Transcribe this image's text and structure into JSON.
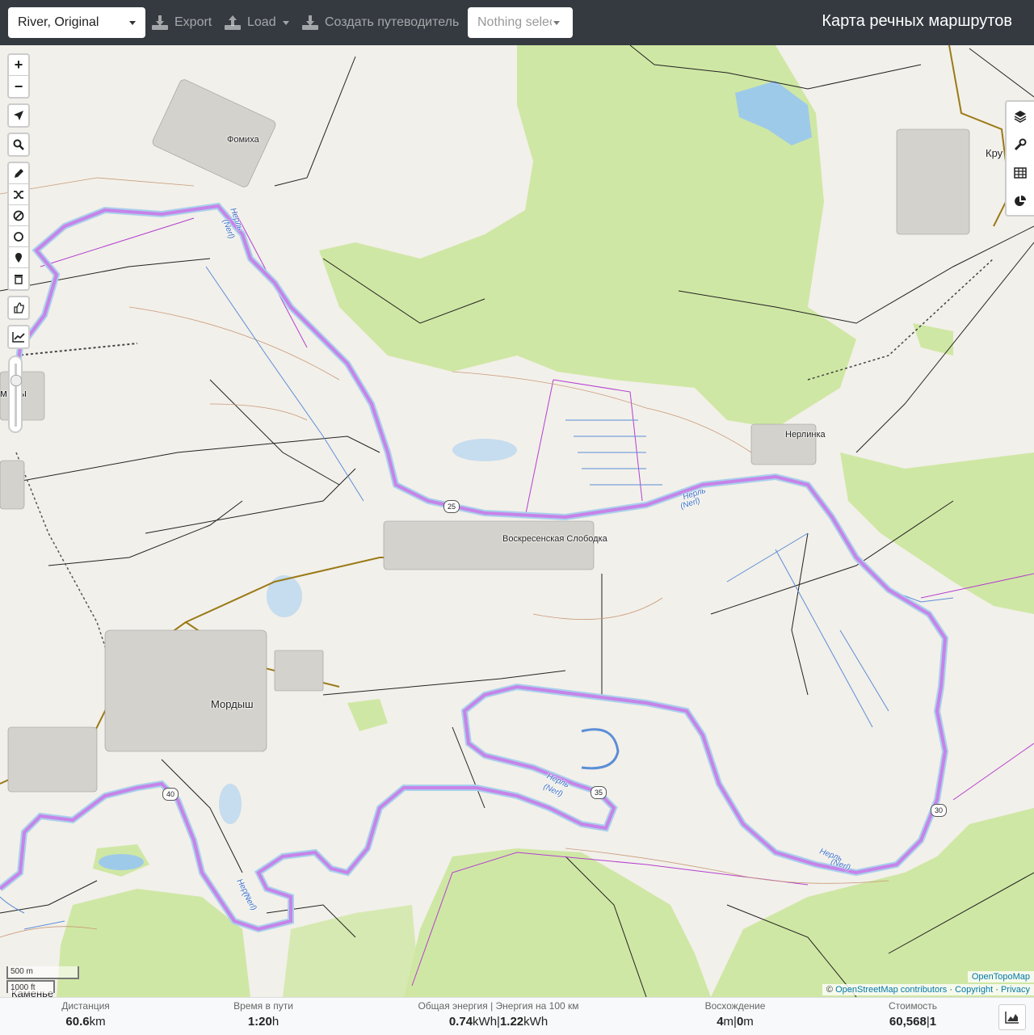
{
  "topbar": {
    "profile": "River, Original",
    "export_label": "Export",
    "load_label": "Load",
    "guide_label": "Создать путеводитель",
    "selection_label": "Nothing selected",
    "title": "Карта речных маршрутов"
  },
  "map": {
    "left_controls": [
      "zoom-in",
      "zoom-out",
      "locate",
      "search",
      "draw-route",
      "reverse-route",
      "delete-point",
      "add-circle",
      "add-marker",
      "clear-route",
      "strava-segments",
      "elevation-chart"
    ],
    "zoom_in": "+",
    "zoom_out": "−",
    "right_controls": [
      "layers-icon",
      "wrench-icon",
      "table-icon",
      "pie-chart-icon"
    ],
    "places": {
      "fomikha": "Фомиха",
      "nerlinka": "Нерлинка",
      "voskresenskaya": "Воскресенская Слободка",
      "mordysh": "Мордыш",
      "kru": "Кру",
      "mitsy": "мицы",
      "kamenye": "Каменье"
    },
    "river_labels": {
      "r1": "Нерль",
      "r1b": "(Nerl)",
      "r2": "Нерль",
      "r2b": "(Nerl)",
      "r3": "Нерль",
      "r3b": "(Nerl)",
      "r4": "Нерль",
      "r4b": "(Nerl)",
      "r5": "Нерль",
      "r5b": "(Nerl)"
    },
    "km_markers": {
      "k25": "25",
      "k30": "30",
      "k35": "35",
      "k40": "40"
    },
    "scale_metric": "500 m",
    "scale_imperial": "1000 ft",
    "attribution": {
      "tile": "OpenTopoMap",
      "prefix": "©",
      "osm": "OpenStreetMap contributors",
      "sep1": "·",
      "copyright": "Copyright",
      "sep2": "·",
      "privacy": "Privacy"
    }
  },
  "stats": {
    "distance_label": "Дистанция",
    "distance_value": "60.6",
    "distance_unit": "km",
    "time_label": "Время в пути",
    "time_value": "1:20",
    "time_unit": "h",
    "energy_label": "Общая энергия | Энергия на 100 км",
    "energy_total": "0.74",
    "energy_unit": "kWh",
    "energy_sep": "|",
    "energy_per100": "1.22",
    "energy_unit2": "kWh",
    "ascent_label": "Восхождение",
    "ascent_value": "4",
    "ascent_unit": "m",
    "ascent_sep": "|",
    "descent_value": "0",
    "descent_unit": "m",
    "cost_label": "Стоимость",
    "cost_value": "60,568",
    "cost_sep": "|",
    "cost_value2": "1"
  },
  "colors": {
    "route": "#c87ee8",
    "river": "#9ecae9",
    "forest": "#cfe7a4",
    "topbar": "#343a40"
  }
}
